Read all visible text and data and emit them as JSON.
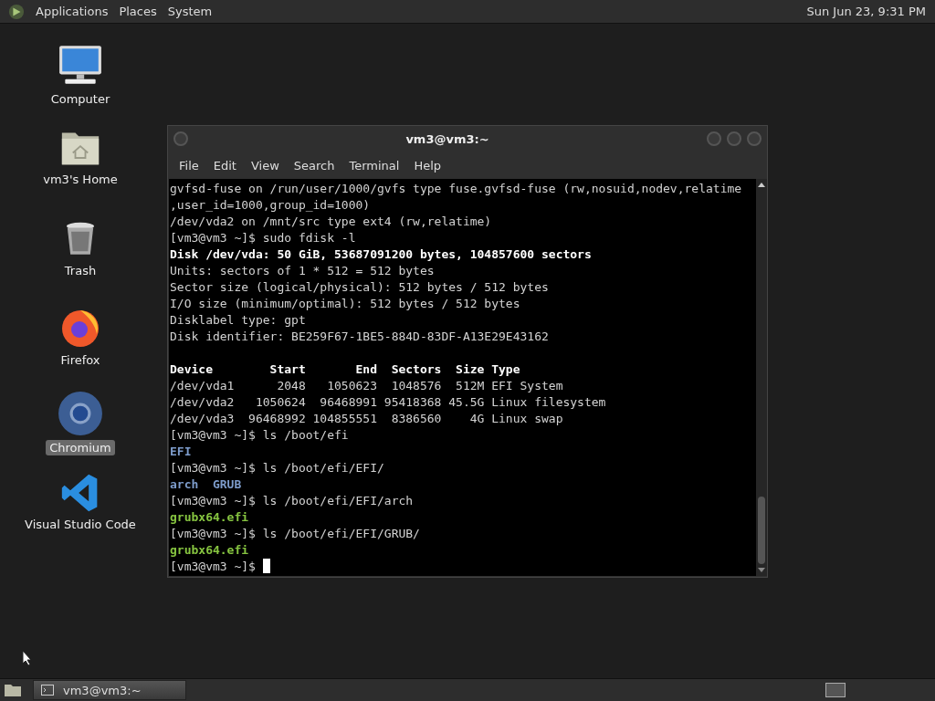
{
  "top_panel": {
    "menus": [
      "Applications",
      "Places",
      "System"
    ],
    "clock": "Sun Jun 23,  9:31 PM"
  },
  "desktop_icons": [
    {
      "kind": "computer",
      "label": "Computer",
      "selected": false
    },
    {
      "kind": "home",
      "label": "vm3's Home",
      "selected": false
    },
    {
      "kind": "trash",
      "label": "Trash",
      "selected": false
    },
    {
      "kind": "firefox",
      "label": "Firefox",
      "selected": false
    },
    {
      "kind": "chromium",
      "label": "Chromium",
      "selected": true
    },
    {
      "kind": "vscode",
      "label": "Visual Studio Code",
      "selected": false
    }
  ],
  "window": {
    "title": "vm3@vm3:~",
    "menus": [
      "File",
      "Edit",
      "View",
      "Search",
      "Terminal",
      "Help"
    ],
    "lines": [
      {
        "kind": "plain",
        "text": "gvfsd-fuse on /run/user/1000/gvfs type fuse.gvfsd-fuse (rw,nosuid,nodev,relatime"
      },
      {
        "kind": "plain",
        "text": ",user_id=1000,group_id=1000)"
      },
      {
        "kind": "plain",
        "text": "/dev/vda2 on /mnt/src type ext4 (rw,relatime)"
      },
      {
        "kind": "plain",
        "text": "[vm3@vm3 ~]$ sudo fdisk -l"
      },
      {
        "kind": "bold",
        "text": "Disk /dev/vda: 50 GiB, 53687091200 bytes, 104857600 sectors"
      },
      {
        "kind": "plain",
        "text": "Units: sectors of 1 * 512 = 512 bytes"
      },
      {
        "kind": "plain",
        "text": "Sector size (logical/physical): 512 bytes / 512 bytes"
      },
      {
        "kind": "plain",
        "text": "I/O size (minimum/optimal): 512 bytes / 512 bytes"
      },
      {
        "kind": "plain",
        "text": "Disklabel type: gpt"
      },
      {
        "kind": "plain",
        "text": "Disk identifier: BE259F67-1BE5-884D-83DF-A13E29E43162"
      },
      {
        "kind": "blank"
      },
      {
        "kind": "bold",
        "text": "Device        Start       End  Sectors  Size Type"
      },
      {
        "kind": "plain",
        "text": "/dev/vda1      2048   1050623  1048576  512M EFI System"
      },
      {
        "kind": "plain",
        "text": "/dev/vda2   1050624  96468991 95418368 45.5G Linux filesystem"
      },
      {
        "kind": "plain",
        "text": "/dev/vda3  96468992 104855551  8386560    4G Linux swap"
      },
      {
        "kind": "plain",
        "text": "[vm3@vm3 ~]$ ls /boot/efi"
      },
      {
        "kind": "dir",
        "text": "EFI"
      },
      {
        "kind": "plain",
        "text": "[vm3@vm3 ~]$ ls /boot/efi/EFI/"
      },
      {
        "kind": "dir",
        "text": "arch  GRUB"
      },
      {
        "kind": "plain",
        "text": "[vm3@vm3 ~]$ ls /boot/efi/EFI/arch"
      },
      {
        "kind": "exe",
        "text": "grubx64.efi"
      },
      {
        "kind": "plain",
        "text": "[vm3@vm3 ~]$ ls /boot/efi/EFI/GRUB/"
      },
      {
        "kind": "exe",
        "text": "grubx64.efi"
      },
      {
        "kind": "prompt",
        "text": "[vm3@vm3 ~]$ "
      }
    ]
  },
  "taskbar": {
    "tasks": [
      {
        "label": "vm3@vm3:~",
        "selected": false
      }
    ]
  }
}
